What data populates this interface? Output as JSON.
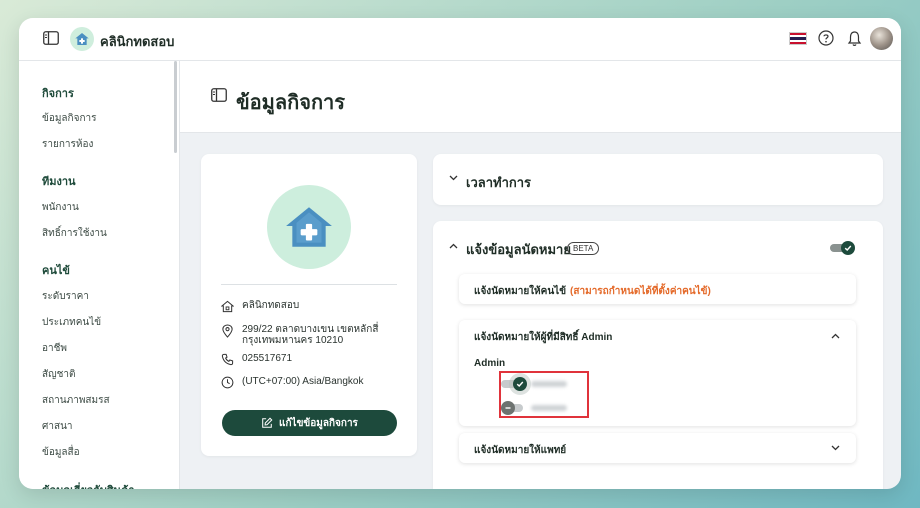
{
  "topbar": {
    "brand_name": "คลินิกทดสอบ"
  },
  "sidebar": {
    "sections": [
      {
        "title": "กิจการ",
        "items": [
          "ข้อมูลกิจการ",
          "รายการห้อง"
        ]
      },
      {
        "title": "ทีมงาน",
        "items": [
          "พนักงาน",
          "สิทธิ์การใช้งาน"
        ]
      },
      {
        "title": "คนไข้",
        "items": [
          "ระดับราคา",
          "ประเภทคนไข้",
          "อาชีพ",
          "สัญชาติ",
          "สถานภาพสมรส",
          "ศาสนา",
          "ข้อมูลสื่อ"
        ]
      },
      {
        "title": "ข้อมูลเกี่ยวกับสินค้า",
        "items": []
      }
    ]
  },
  "page": {
    "title": "ข้อมูลกิจการ"
  },
  "profile": {
    "name": "คลินิกทดสอบ",
    "address": "299/22 ตลาดบางเขน เขตหลักสี่ กรุงเทพมหานคร 10210",
    "phone": "025517671",
    "timezone": "(UTC+07:00) Asia/Bangkok",
    "edit_button": "แก้ไขข้อมูลกิจการ"
  },
  "hours": {
    "title": "เวลาทำการ"
  },
  "notify": {
    "title": "แจ้งข้อมูลนัดหมาย",
    "badge": "BETA",
    "enabled": true,
    "patient": {
      "title": "แจ้งนัดหมายให้คนไข้",
      "note": "(สามารถกำหนดได้ที่ตั้งค่าคนไข้)"
    },
    "admin": {
      "title": "แจ้งนัดหมายให้ผู้ที่มีสิทธิ์ Admin",
      "group_label": "Admin",
      "toggles": [
        {
          "on": true
        },
        {
          "on": false
        }
      ]
    },
    "doctor": {
      "title": "แจ้งนัดหมายให้แพทย์"
    }
  },
  "colors": {
    "brand": "#1d4a3c",
    "accent_orange": "#e46a2a",
    "highlight_red": "#e0333b",
    "logo_bg": "#cdeedd"
  }
}
